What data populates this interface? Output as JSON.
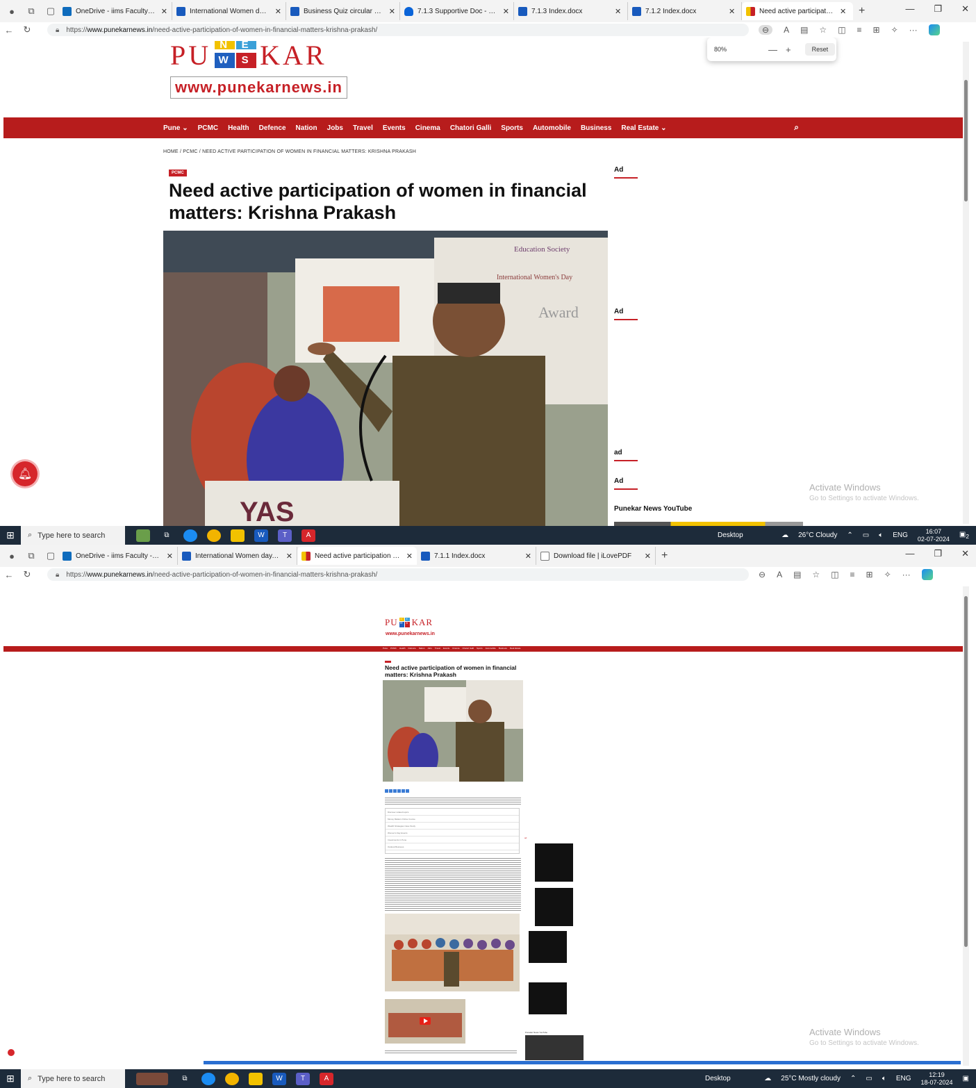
{
  "shot1": {
    "tabs": [
      {
        "title": "OneDrive - iims Faculty - Outlo",
        "icon": "outlook-icon"
      },
      {
        "title": "International Women day.docx",
        "icon": "word-icon"
      },
      {
        "title": "Business Quiz circular 2019.do",
        "icon": "word-icon"
      },
      {
        "title": "7.1.3 Supportive Doc - OneDri",
        "icon": "onedrive-icon"
      },
      {
        "title": "7.1.3 Index.docx",
        "icon": "word-icon"
      },
      {
        "title": "7.1.2 Index.docx",
        "icon": "word-icon"
      },
      {
        "title": "Need active participation of w",
        "icon": "punekar-icon",
        "active": true
      }
    ],
    "url_prefix": "https://",
    "url_host": "www.punekarnews.in",
    "url_path": "/need-active-participation-of-women-in-financial-matters-krishna-prakash/",
    "zoom_popup": {
      "value": "80%",
      "minus": "—",
      "plus": "+",
      "reset": "Reset"
    },
    "logo": {
      "left": "PU",
      "right": "KAR",
      "tiles": [
        "N",
        "E",
        "W",
        "S"
      ]
    },
    "logo_url": "www.punekarnews.in",
    "nav": [
      "Pune ⌄",
      "PCMC",
      "Health",
      "Defence",
      "Nation",
      "Jobs",
      "Travel",
      "Events",
      "Cinema",
      "Chatori Galli",
      "Sports",
      "Automobile",
      "Business",
      "Real Estate ⌄"
    ],
    "breadcrumb": "HOME / PCMC / NEED ACTIVE PARTICIPATION OF WOMEN IN FINANCIAL MATTERS: KRISHNA PRAKASH",
    "category": "PCMC",
    "headline": "Need active participation of women in financial matters: Krishna Prakash",
    "photo_text": {
      "banner1": "Education Society",
      "banner2": "International Women's Day",
      "banner3": "Award",
      "podium": "YAS"
    },
    "sidebar": [
      "Ad",
      "Ad",
      "ad",
      "Ad"
    ],
    "yt_heading": "Punekar News YouTube",
    "activate_title": "Activate Windows",
    "activate_sub": "Go to Settings to activate Windows.",
    "taskbar": {
      "search": "Type here to search",
      "desktop": "Desktop",
      "weather": "26°C  Cloudy",
      "lang": "ENG",
      "time": "16:07",
      "date": "02-07-2024",
      "notif": "2"
    }
  },
  "shot2": {
    "tabs": [
      {
        "title": "OneDrive - iims Faculty - Outloo",
        "icon": "outlook-icon"
      },
      {
        "title": "International Women day.docx",
        "icon": "word-icon"
      },
      {
        "title": "Need active participation of wor",
        "icon": "punekar-icon",
        "active": true
      },
      {
        "title": "7.1.1 Index.docx",
        "icon": "word-icon"
      },
      {
        "title": "Download file | iLovePDF",
        "icon": "document-icon"
      }
    ],
    "url_prefix": "https://",
    "url_host": "www.punekarnews.in",
    "url_path": "/need-active-participation-of-women-in-financial-matters-krishna-prakash/",
    "logo": {
      "left": "PU",
      "right": "KAR",
      "tiles": [
        "N",
        "E",
        "W",
        "S"
      ]
    },
    "logo_url": "www.punekarnews.in",
    "nav": [
      "Pune",
      "PCMC",
      "Health",
      "Defence",
      "Nation",
      "Jobs",
      "Travel",
      "Events",
      "Cinema",
      "Chatori Galli",
      "Sports",
      "Automobile",
      "Business",
      "Real Estate"
    ],
    "headline": "Need active participation of women in financial matters: Krishna Prakash",
    "related_heading": "Discover related topics",
    "related": [
      "Money Matters Online Course",
      "Wealth Strategies Case Study",
      "Women's Day Events",
      "Investments in Pune",
      "Outlook Business"
    ],
    "yt_heading": "Punekar News YouTube",
    "activate_title": "Activate Windows",
    "activate_sub": "Go to Settings to activate Windows.",
    "taskbar": {
      "search": "Type here to search",
      "desktop": "Desktop",
      "weather": "25°C  Mostly cloudy",
      "lang": "ENG",
      "time": "12:19",
      "date": "18-07-2024"
    }
  },
  "colors": {
    "brand_red": "#c62026",
    "nav_red": "#b71c1c",
    "taskbar": "#1d2b3a"
  }
}
